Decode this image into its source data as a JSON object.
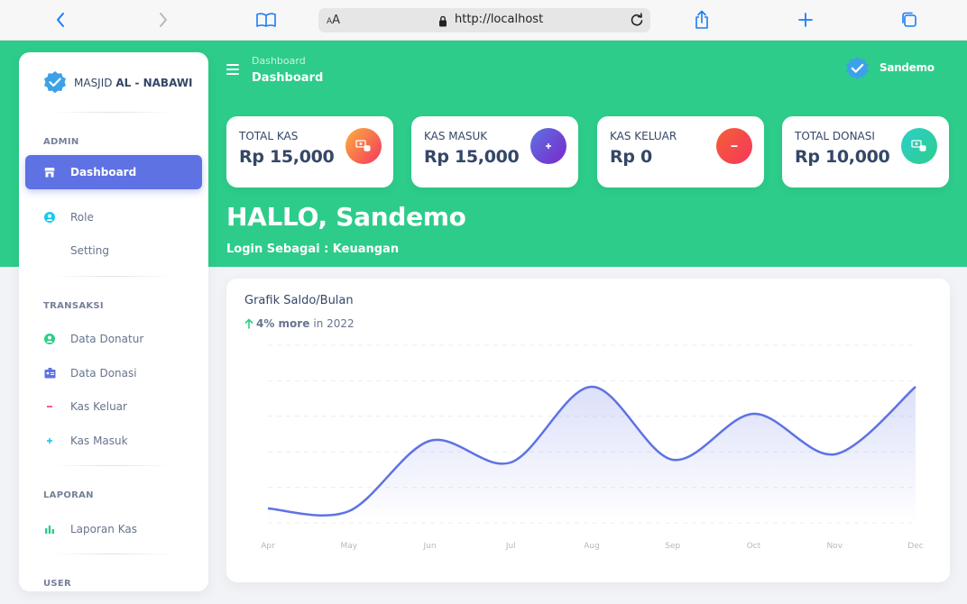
{
  "browser": {
    "url": "http://localhost",
    "text_size_label": "AA"
  },
  "sidebar": {
    "brand_prefix": "MASJID",
    "brand_name": "AL - NABAWI",
    "sections": [
      {
        "title": "ADMIN",
        "items": [
          {
            "label": "Dashboard",
            "icon": "shop-icon",
            "active": true
          },
          {
            "label": "Role",
            "icon": "user-circle-icon"
          },
          {
            "label": "Setting",
            "icon": ""
          }
        ]
      },
      {
        "title": "TRANSAKSI",
        "items": [
          {
            "label": "Data Donatur",
            "icon": "user-circle-icon"
          },
          {
            "label": "Data Donasi",
            "icon": "id-card-icon"
          },
          {
            "label": "Kas Keluar",
            "icon": "minus-icon"
          },
          {
            "label": "Kas Masuk",
            "icon": "plus-icon"
          }
        ]
      },
      {
        "title": "LAPORAN",
        "items": [
          {
            "label": "Laporan Kas",
            "icon": "bar-chart-icon"
          }
        ]
      },
      {
        "title": "USER",
        "items": []
      }
    ]
  },
  "header": {
    "breadcrumb_parent": "Dashboard",
    "breadcrumb_current": "Dashboard",
    "user_name": "Sandemo"
  },
  "stats": [
    {
      "label": "TOTAL KAS",
      "value": "Rp 15,000",
      "icon": "money-coins-icon",
      "color": "#fb7d3a"
    },
    {
      "label": "KAS MASUK",
      "value": "Rp 15,000",
      "icon": "plus-icon",
      "color": "#7356e8"
    },
    {
      "label": "KAS KELUAR",
      "value": "Rp 0",
      "icon": "minus-icon",
      "color": "#f5365c"
    },
    {
      "label": "TOTAL DONASI",
      "value": "Rp 10,000",
      "icon": "money-coins-icon",
      "color": "#2dcca6"
    }
  ],
  "greeting": "HALLO, Sandemo",
  "login_as": "Login Sebagai : Keuangan",
  "chart_data": {
    "type": "line",
    "title": "Grafik Saldo/Bulan",
    "subtitle_highlight": "4% more",
    "subtitle_rest": "in 2022",
    "categories": [
      "Apr",
      "May",
      "Jun",
      "Jul",
      "Aug",
      "Sep",
      "Oct",
      "Nov",
      "Dec"
    ],
    "series": [
      {
        "values": [
          50,
          40,
          300,
          220,
          500,
          230,
          400,
          250,
          500
        ]
      }
    ],
    "ylim": [
      0,
      600
    ],
    "grid": true,
    "color": "#5e72e4",
    "fill": "area-gradient"
  }
}
